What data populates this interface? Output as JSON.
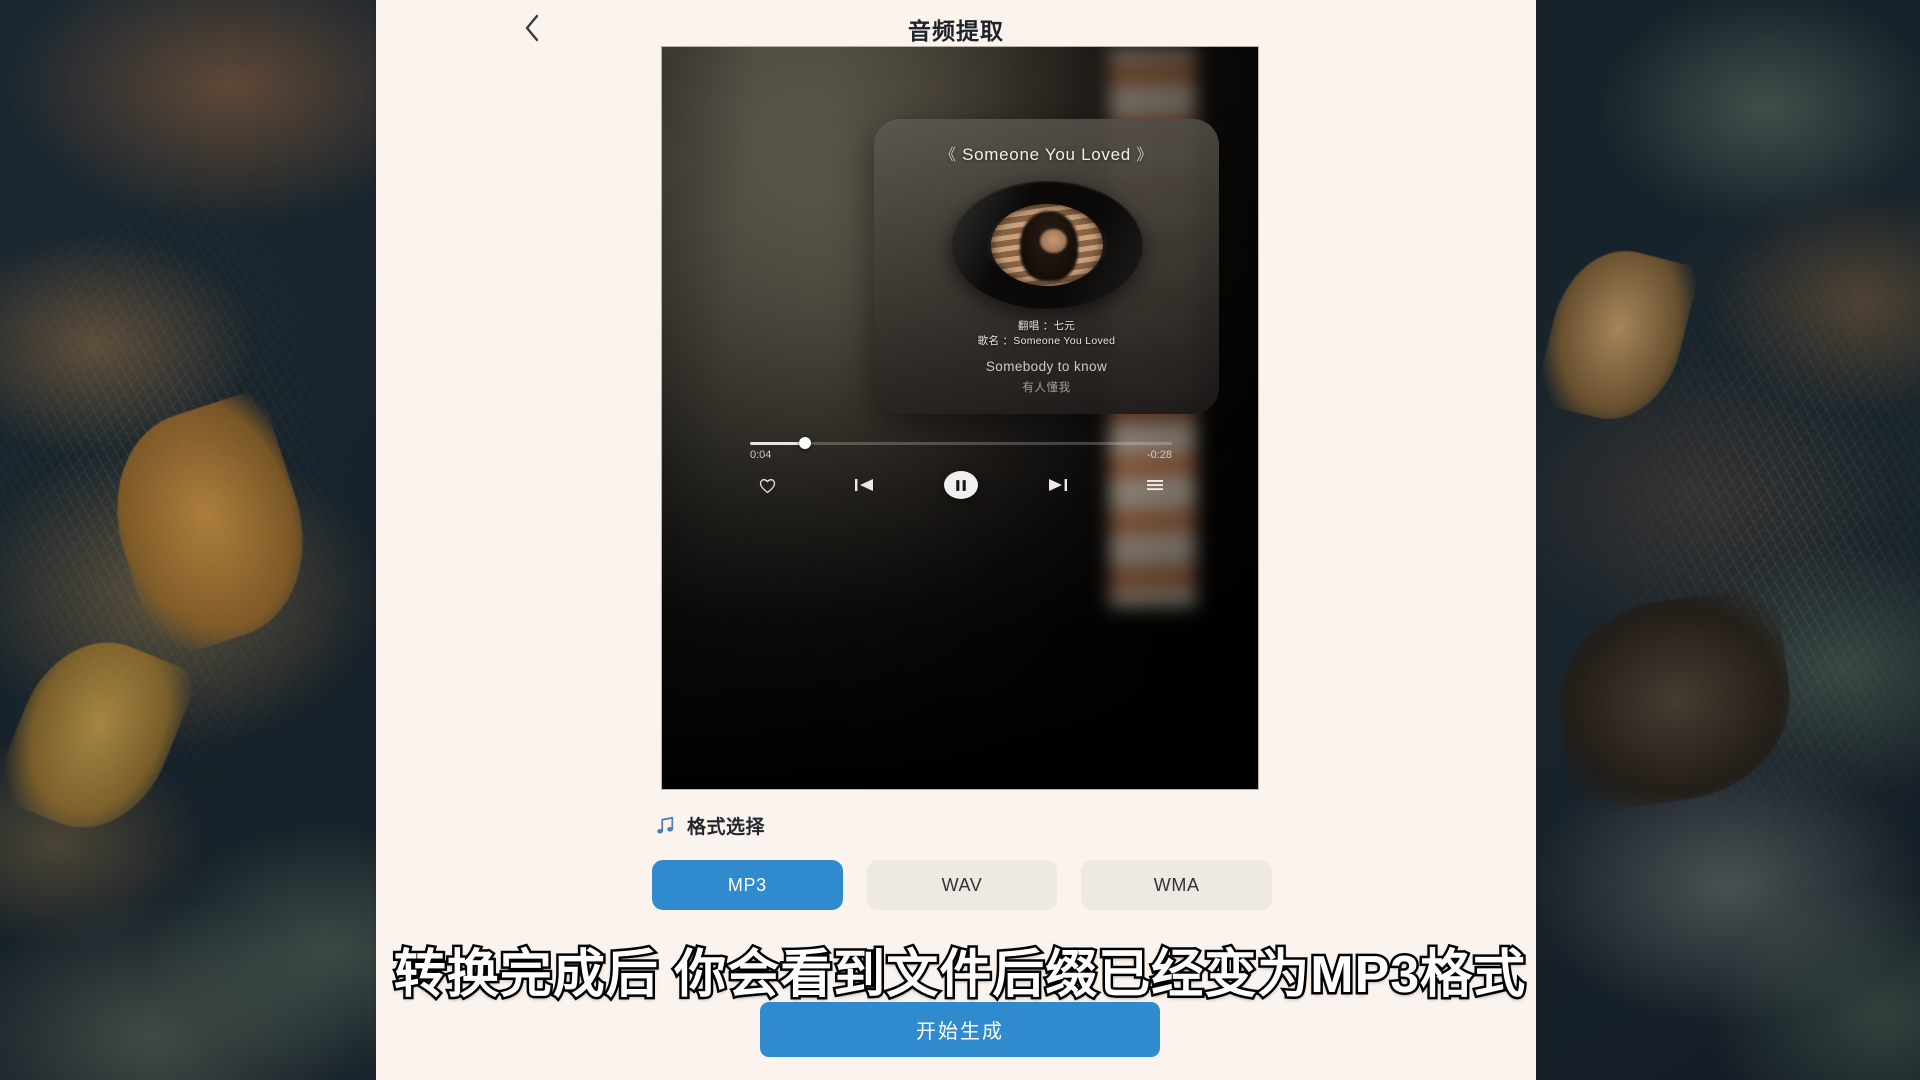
{
  "header": {
    "title": "音频提取",
    "back_icon": "chevron-left-icon"
  },
  "player": {
    "song_title_prefix": "《",
    "song_title": "Someone You Loved",
    "song_title_suffix": "》",
    "meta": [
      "翻唱 ：七元",
      "歌名 ：Someone You Loved"
    ],
    "lyric_en": "Somebody to know",
    "lyric_cn": "有人懂我",
    "time_elapsed": "0:04",
    "time_remaining": "-0:28",
    "progress_percent": 13,
    "controls": {
      "favorite_icon": "heart-icon",
      "previous_icon": "previous-track-icon",
      "play_pause_icon": "pause-icon",
      "next_icon": "next-track-icon",
      "playlist_icon": "playlist-menu-icon"
    }
  },
  "format_section": {
    "icon": "music-note-icon",
    "label": "格式选择",
    "options": [
      {
        "label": "MP3",
        "selected": true
      },
      {
        "label": "WAV",
        "selected": false
      },
      {
        "label": "WMA",
        "selected": false
      }
    ]
  },
  "generate_button": {
    "label": "开始生成"
  },
  "subtitle": {
    "text": "转换完成后 你会看到文件后缀已经变为MP3格式"
  },
  "colors": {
    "accent": "#2f8bcd",
    "app_background": "#faf3ee",
    "unselected_chip": "#efe9e3",
    "title_text": "#20242a"
  }
}
